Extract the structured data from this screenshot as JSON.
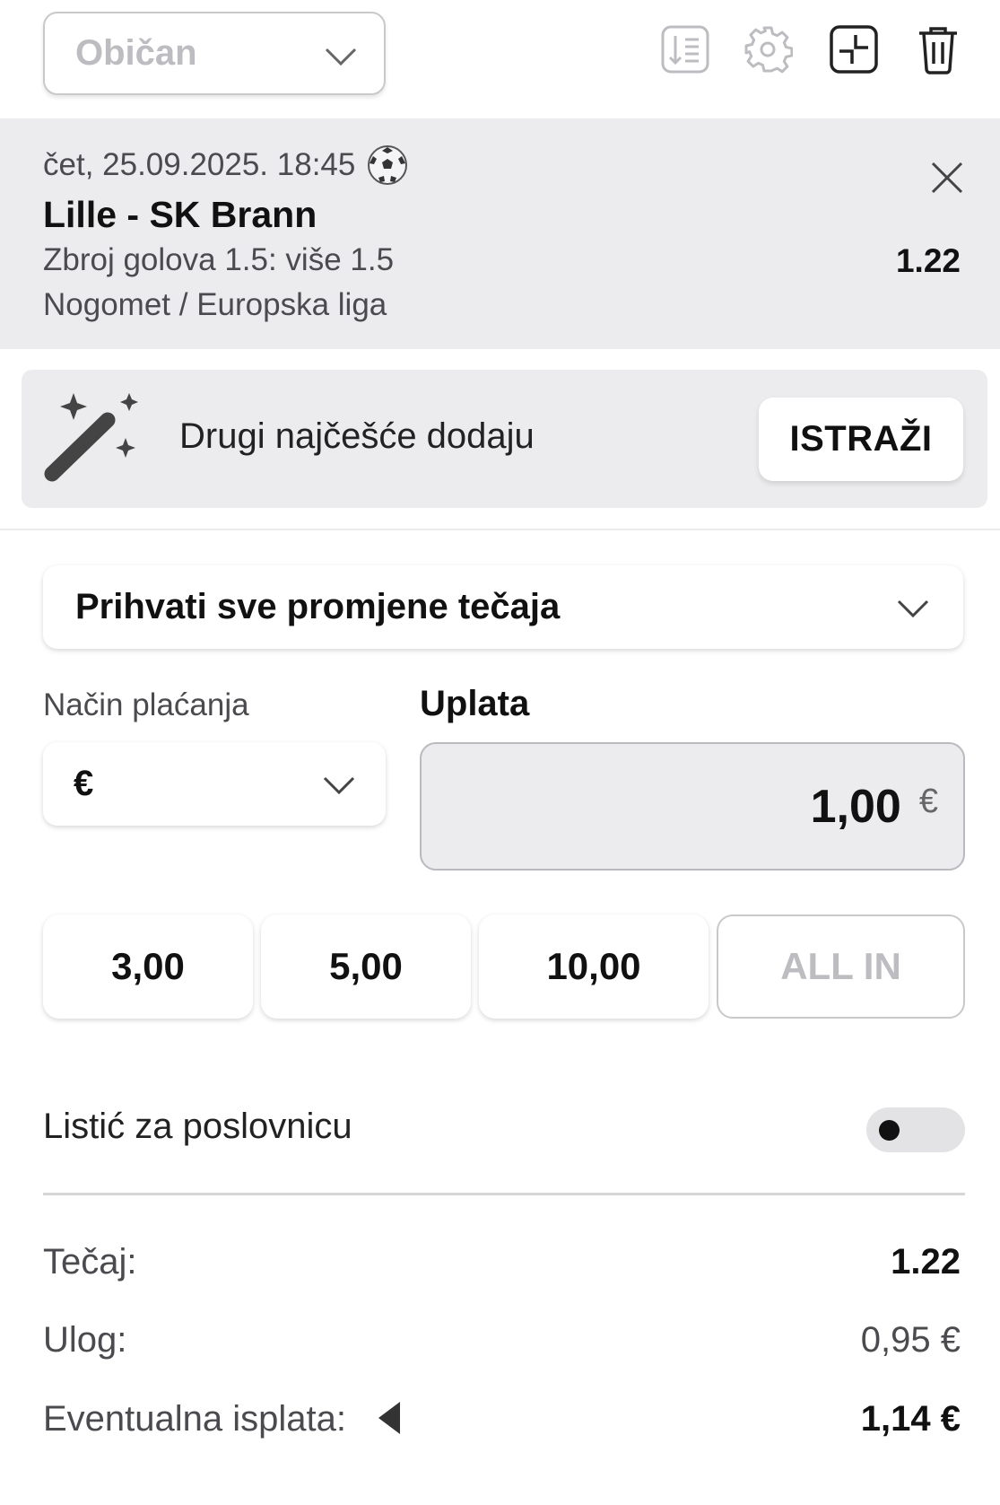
{
  "top_bar": {
    "ticket_type": "Običan",
    "icons": [
      "sort-list-icon",
      "gear-icon",
      "collapse-icon",
      "trash-icon"
    ]
  },
  "selection": {
    "datetime": "čet, 25.09.2025. 18:45",
    "sport_icon": "soccer-ball-icon",
    "match": "Lille - SK Brann",
    "market": "Zbroj golova 1.5: više 1.5",
    "league": "Nogomet / Europska liga",
    "odd": "1.22"
  },
  "suggestion": {
    "text": "Drugi najčešće dodaju",
    "button": "ISTRAŽI"
  },
  "odds_change": {
    "selected": "Prihvati sve promjene tečaja"
  },
  "payment": {
    "label": "Način plaćanja",
    "selected": "€"
  },
  "stake": {
    "label": "Uplata",
    "value": "1,00",
    "currency": "€"
  },
  "quick_amounts": [
    "3,00",
    "5,00",
    "10,00",
    "ALL IN"
  ],
  "business": {
    "label": "Listić za poslovnicu",
    "enabled": false
  },
  "summary": {
    "odds_label": "Tečaj:",
    "odds_value": "1.22",
    "stake_label": "Ulog:",
    "stake_value": "0,95 €",
    "payout_label": "Eventualna isplata:",
    "payout_value": "1,14 €"
  },
  "colors": {
    "panel_bg": "#ececee",
    "disabled_text": "#bcbcc1",
    "primary_text": "#111111",
    "secondary_text": "#4a4a4f"
  }
}
